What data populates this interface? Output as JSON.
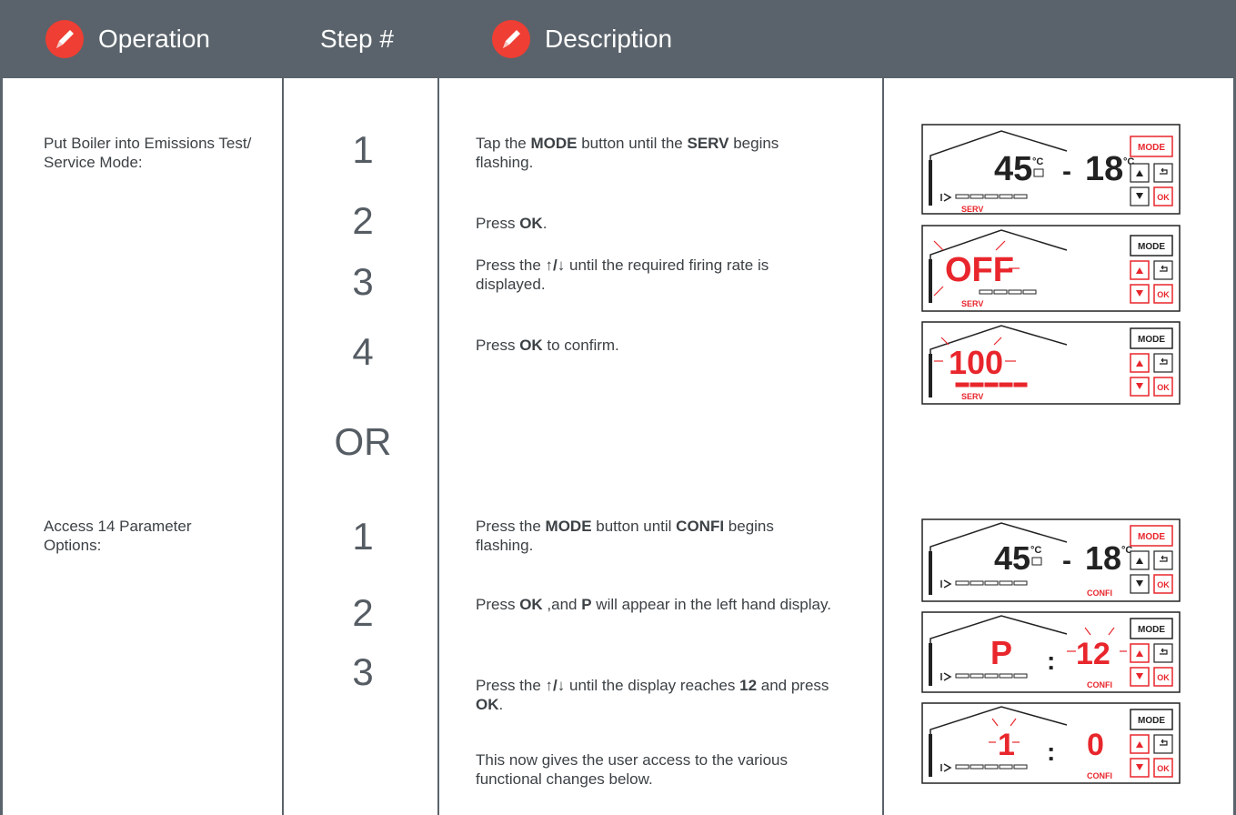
{
  "header": {
    "operation": "Operation",
    "step": "Step #",
    "description": "Description"
  },
  "operations": {
    "op1": "Put Boiler into Emissions Test/ Service Mode:",
    "op2": "Access 14 Parameter Options:"
  },
  "steps": {
    "s1": "1",
    "s2": "2",
    "s3": "3",
    "s4": "4",
    "or": "OR",
    "s5": "1",
    "s6": "2",
    "s7": "3"
  },
  "descriptions": {
    "d1": {
      "a": "Tap the ",
      "b": "MODE",
      "c": " button until the ",
      "d": "SERV",
      "e": " begins flashing."
    },
    "d2": {
      "a": "Press ",
      "b": "OK",
      "c": "."
    },
    "d3": {
      "a": "Press the ",
      "arrows": "↑/↓",
      "b": " until the required firing rate is displayed."
    },
    "d4": {
      "a": "Press ",
      "b": "OK",
      "c": " to confirm."
    },
    "d5": {
      "a": "Press the ",
      "b": "MODE",
      "c": " button until ",
      "d": "CONFI",
      "e": " begins flashing."
    },
    "d6": {
      "a": "Press ",
      "b": "OK",
      "c": " ,and ",
      "d": "P",
      "e": " will appear in the left hand display."
    },
    "d7": {
      "a": "Press the ",
      "arrows": "↑/↓",
      "b": " until the display reaches ",
      "c": "12",
      "d": " and press ",
      "e": "OK",
      "f": "."
    },
    "d8": "This now gives the user access to the various functional changes below."
  },
  "panels": {
    "mode_label": "MODE",
    "ok_label": "OK",
    "p1": {
      "main": "45",
      "unit": "°C",
      "sep": "-",
      "right": "18",
      "runit": "°C",
      "tag": "SERV"
    },
    "p2": {
      "main": "OFF",
      "tag": "SERV"
    },
    "p3": {
      "main": "100",
      "tag": "SERV"
    },
    "p4": {
      "main": "45",
      "unit": "°C",
      "sep": "-",
      "right": "18",
      "runit": "°C",
      "tag": "CONFI"
    },
    "p5": {
      "left": "P",
      "colon": ":",
      "right": "12",
      "tag": "CONFI"
    },
    "p6": {
      "left": "1",
      "colon": ":",
      "right": "0",
      "tag": "CONFI"
    }
  },
  "colors": {
    "header_bg": "#5a636b",
    "accent_red": "#ef3e33",
    "lcd_red": "#e8262c"
  }
}
